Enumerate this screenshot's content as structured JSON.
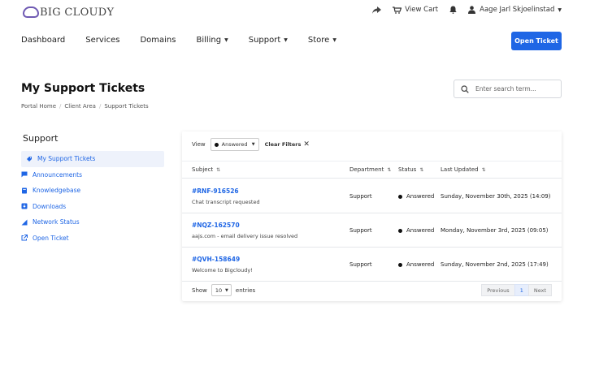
{
  "brand": {
    "name": "BIG CLOUDY"
  },
  "header": {
    "share_icon": "share-icon",
    "cart_label": "View Cart",
    "notifications_icon": "bell-icon",
    "user_name": "Aage Jarl Skjoelinstad"
  },
  "nav": {
    "items": [
      {
        "label": "Dashboard"
      },
      {
        "label": "Services"
      },
      {
        "label": "Domains"
      },
      {
        "label": "Billing"
      },
      {
        "label": "Support"
      },
      {
        "label": "Store"
      }
    ],
    "open_ticket_label": "Open Ticket"
  },
  "page": {
    "title": "My Support Tickets",
    "breadcrumb": [
      "Portal Home",
      "Client Area",
      "Support Tickets"
    ],
    "search_placeholder": "Enter search term..."
  },
  "sidebar": {
    "title": "Support",
    "items": [
      {
        "label": "My Support Tickets",
        "icon": "ticket-icon"
      },
      {
        "label": "Announcements",
        "icon": "chat-icon"
      },
      {
        "label": "Knowledgebase",
        "icon": "book-icon"
      },
      {
        "label": "Downloads",
        "icon": "download-icon"
      },
      {
        "label": "Network Status",
        "icon": "signal-icon"
      },
      {
        "label": "Open Ticket",
        "icon": "external-link-icon"
      }
    ]
  },
  "tickets": {
    "view_label": "View",
    "view_filter": "Answered",
    "clear_filters_label": "Clear Filters",
    "columns": {
      "subject": "Subject",
      "department": "Department",
      "status": "Status",
      "last_updated": "Last Updated"
    },
    "rows": [
      {
        "id": "#RNF-916526",
        "subject": "Chat transcript requested",
        "department": "Support",
        "status": "Answered",
        "last_updated": "Sunday, November 30th, 2025 (14:09)"
      },
      {
        "id": "#NQZ-162570",
        "subject": "aajs.com - email delivery issue resolved",
        "department": "Support",
        "status": "Answered",
        "last_updated": "Monday, November 3rd, 2025 (09:05)"
      },
      {
        "id": "#QVH-158649",
        "subject": "Welcome to Bigcloudy!",
        "department": "Support",
        "status": "Answered",
        "last_updated": "Sunday, November 2nd, 2025 (17:49)"
      }
    ],
    "show_label": "Show",
    "per_page": "10",
    "entries_label": "entries",
    "pagination": {
      "previous": "Previous",
      "current": "1",
      "next": "Next"
    }
  },
  "colors": {
    "accent": "#1f66e5",
    "brand_purple": "#6f5ab3"
  }
}
